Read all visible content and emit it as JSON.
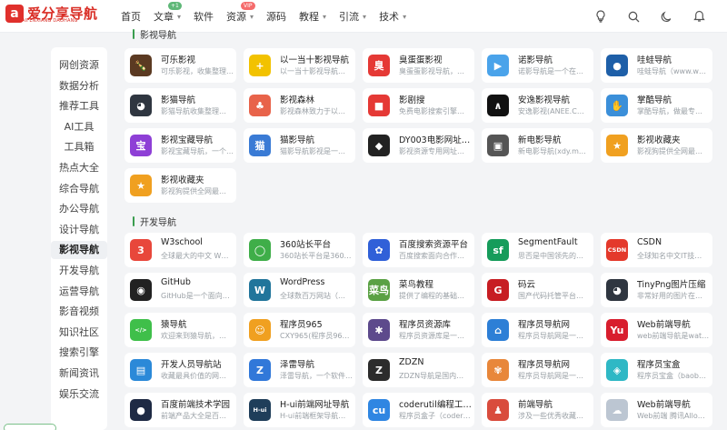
{
  "header": {
    "logo_text": "爱分享导航",
    "logo_sub": "AIFENXIANG DAOHANG",
    "nav": [
      {
        "label": "首页",
        "chevron": false
      },
      {
        "label": "文章",
        "chevron": true,
        "badge": "+1"
      },
      {
        "label": "软件",
        "chevron": false
      },
      {
        "label": "资源",
        "chevron": true,
        "badge": "VIP"
      },
      {
        "label": "源码",
        "chevron": false
      },
      {
        "label": "教程",
        "chevron": true
      },
      {
        "label": "引流",
        "chevron": true
      },
      {
        "label": "技术",
        "chevron": true
      }
    ]
  },
  "sidebar": {
    "items": [
      "网创资源",
      "数据分析",
      "推荐工具",
      "AI工具",
      "工具箱",
      "热点大全",
      "综合导航",
      "办公导航",
      "设计导航",
      "影视导航",
      "开发导航",
      "运营导航",
      "影音视频",
      "知识社区",
      "搜索引擎",
      "新闻资讯",
      "娱乐交流"
    ],
    "active_index": 9
  },
  "sections": {
    "video_title": "影视导航",
    "dev_title": "开发导航"
  },
  "video_cards": [
    {
      "title": "可乐影视",
      "desc": "可乐影视，收集整理…",
      "icon": "cola-icon",
      "color": "#5b3a22",
      "glyph": "🍾"
    },
    {
      "title": "以一当十影视导航",
      "desc": "以一当十影视导航…",
      "icon": "plus-icon",
      "color": "#f2c200",
      "glyph": "+"
    },
    {
      "title": "臭蛋蛋影视",
      "desc": "臭蛋蛋影视导航，…",
      "icon": "red-face-icon",
      "color": "#e53935",
      "glyph": "臭"
    },
    {
      "title": "诺影导航",
      "desc": "诺影导航是一个在…",
      "icon": "play-icon",
      "color": "#4aa3ea",
      "glyph": "▶"
    },
    {
      "title": "哇蛙导航",
      "desc": "哇蛙导航（www.w…",
      "icon": "frog-icon",
      "color": "#1e5fa8",
      "glyph": "●"
    },
    {
      "title": "影猫导航",
      "desc": "影猫导航收集整理…",
      "icon": "panda-icon",
      "color": "#2f3640",
      "glyph": "◕"
    },
    {
      "title": "影视森林",
      "desc": "影视森林致力于以…",
      "icon": "forest-icon",
      "color": "#e8634a",
      "glyph": "♣"
    },
    {
      "title": "影剧搜",
      "desc": "免费电影搜索引擎…",
      "icon": "camera-icon",
      "color": "#e53935",
      "glyph": "■"
    },
    {
      "title": "安逸影视导航",
      "desc": "安逸影视(ANEE.C…",
      "icon": "arrow-up-icon",
      "color": "#111111",
      "glyph": "∧"
    },
    {
      "title": "掌酷导航",
      "desc": "掌酷导航，做最专…",
      "icon": "hand-icon",
      "color": "#3b8fd9",
      "glyph": "✋"
    },
    {
      "title": "影视宝藏导航",
      "desc": "影视宝藏导航，一个…",
      "icon": "treasure-icon",
      "color": "#8e3fd6",
      "glyph": "宝"
    },
    {
      "title": "猫影导航",
      "desc": "猫影导航影视是一…",
      "icon": "cat-icon",
      "color": "#3a7bd5",
      "glyph": "猫"
    },
    {
      "title": "DY003电影网址…",
      "desc": "影视资源专用网址…",
      "icon": "cube-icon",
      "color": "#222222",
      "glyph": "◆"
    },
    {
      "title": "新电影导航",
      "desc": "新电影导航(xdy.m…",
      "icon": "video-icon",
      "color": "#555555",
      "glyph": "▣"
    },
    {
      "title": "影视收藏夹",
      "desc": "影视狗提供全网最…",
      "icon": "bookmark-icon",
      "color": "#f0a020",
      "glyph": "★"
    },
    {
      "title": "影视收藏夹",
      "desc": "影视狗提供全网最…",
      "icon": "bookmark-icon",
      "color": "#f0a020",
      "glyph": "★"
    }
  ],
  "dev_cards": [
    {
      "title": "W3school",
      "desc": "全球最大的中文 W…",
      "icon": "w3-icon",
      "color": "#e8473b",
      "glyph": "3"
    },
    {
      "title": "360站长平台",
      "desc": "360站长平台是360…",
      "icon": "360-icon",
      "color": "#3fae49",
      "glyph": "◯"
    },
    {
      "title": "百度搜索资源平台",
      "desc": "百度搜索面向合作…",
      "icon": "baidu-paw-icon",
      "color": "#3060d8",
      "glyph": "✿"
    },
    {
      "title": "SegmentFault",
      "desc": "思否是中国领先的…",
      "icon": "sf-icon",
      "color": "#169c5b",
      "glyph": "sf"
    },
    {
      "title": "CSDN",
      "desc": "全球知名中文IT技…",
      "icon": "csdn-icon",
      "color": "#e4392b",
      "glyph": "CSDN"
    },
    {
      "title": "GitHub",
      "desc": "GitHub是一个面向…",
      "icon": "github-icon",
      "color": "#222222",
      "glyph": "◉"
    },
    {
      "title": "WordPress",
      "desc": "全球数百万网站（…",
      "icon": "wordpress-icon",
      "color": "#21759b",
      "glyph": "W"
    },
    {
      "title": "菜鸟教程",
      "desc": "提供了编程的基础…",
      "icon": "runoob-icon",
      "color": "#5aa144",
      "glyph": "菜鸟"
    },
    {
      "title": "码云",
      "desc": "国产代码托管平台…",
      "icon": "gitee-icon",
      "color": "#c71d23",
      "glyph": "G"
    },
    {
      "title": "TinyPng图片压缩",
      "desc": "非常好用的图片在…",
      "icon": "panda-icon",
      "color": "#2f3640",
      "glyph": "◕"
    },
    {
      "title": "猿导航",
      "desc": "欢迎来到猿导航，…",
      "icon": "code-bubble-icon",
      "color": "#3fbf4a",
      "glyph": "</>"
    },
    {
      "title": "程序员965",
      "desc": "CXY965(程序员96…",
      "icon": "chef-icon",
      "color": "#f0a020",
      "glyph": "☺"
    },
    {
      "title": "程序员资源库",
      "desc": "程序员资源库是一…",
      "icon": "gear-puzzle-icon",
      "color": "#5d4a8c",
      "glyph": "✱"
    },
    {
      "title": "程序员导航网",
      "desc": "程序员导航网是一…",
      "icon": "house-icon",
      "color": "#2d7fd6",
      "glyph": "⌂"
    },
    {
      "title": "Web前端导航",
      "desc": "web前端导航是wat…",
      "icon": "yu-icon",
      "color": "#d81e2e",
      "glyph": "Yu"
    },
    {
      "title": "开发人员导航站",
      "desc": "收藏最具价值的网…",
      "icon": "window-icon",
      "color": "#2b89d8",
      "glyph": "▤"
    },
    {
      "title": "泽雷导航",
      "desc": "泽雷导航，一个软件…",
      "icon": "zlei-icon",
      "color": "#3178d9",
      "glyph": "Z"
    },
    {
      "title": "ZDZN",
      "desc": "ZDZN导航是国内…",
      "icon": "zdzn-icon",
      "color": "#2c2c2c",
      "glyph": "Z"
    },
    {
      "title": "程序员导航网",
      "desc": "程序员导航网是一…",
      "icon": "flower-icon",
      "color": "#e8873a",
      "glyph": "✾"
    },
    {
      "title": "程序员宝盒",
      "desc": "程序员宝盒（baob…",
      "icon": "box-icon",
      "color": "#2fb8c5",
      "glyph": "◈"
    },
    {
      "title": "百度前端技术学园",
      "desc": "前端产品大全是百…",
      "icon": "dark-circle-icon",
      "color": "#1e2a44",
      "glyph": "●"
    },
    {
      "title": "H-ui前端网址导航",
      "desc": "H-ui前端框架导航…",
      "icon": "hui-icon",
      "color": "#1f3e5a",
      "glyph": "H-ui"
    },
    {
      "title": "coderutil编程工…",
      "desc": "程序员盒子（coder…",
      "icon": "coderutil-icon",
      "color": "#2f86e2",
      "glyph": "cu"
    },
    {
      "title": "前端导航",
      "desc": "涉及一些优秀收藏…",
      "icon": "people-icon",
      "color": "#d94c3d",
      "glyph": "♟"
    },
    {
      "title": "Web前端导航",
      "desc": "Web前端 腾讯Allo…",
      "icon": "cloud-icon",
      "color": "#bcc6d2",
      "glyph": "☁"
    }
  ]
}
